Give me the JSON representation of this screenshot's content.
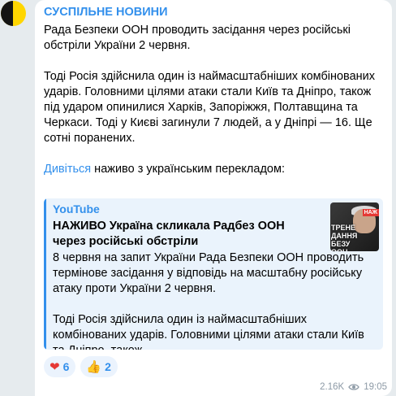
{
  "channel": {
    "name": "СУСПІЛЬНЕ НОВИНИ",
    "avatar_colors": [
      "#141414",
      "#ffd600"
    ]
  },
  "message": {
    "paragraphs": [
      "Рада Безпеки ООН проводить засідання через російські обстріли України 2 червня.",
      "Тоді Росія здійснила один із наймасштабніших комбінованих ударів. Головними цілями атаки стали Київ та Дніпро, також під ударом опинилися Харків, Запоріжжя, Полтавщина та Черкаси. Тоді у Києві загинули 7 людей, а у Дніпрі — 16. Ще сотні поранених."
    ],
    "link_text": "Дивіться",
    "link_suffix": " наживо з українським перекладом:"
  },
  "preview": {
    "site": "YouTube",
    "title": "НАЖИВО Україна скликала Радбез ООН через російські обстріли",
    "description": [
      "8 червня на запит України Рада Безпеки ООН проводить термінове засідання у відповідь на масштабну російську атаку проти України 2 червня.",
      "Тоді Росія здійснила один із наймасштабніших комбінованих ударів. Головними цілями атаки стали Київ та Дніпро, також..."
    ],
    "thumbnail": {
      "tag": "НАЖ",
      "caption": "ТРЕНЕ ДАННЯ БЕЗУ ООН"
    }
  },
  "reactions": [
    {
      "emoji": "heart-icon",
      "glyph": "❤",
      "count": "6"
    },
    {
      "emoji": "thumbs-up-icon",
      "glyph": "👍",
      "count": "2"
    }
  ],
  "meta": {
    "views": "2.16K",
    "time": "19:05"
  },
  "colors": {
    "accent": "#3390ec",
    "background": "#e6ebee",
    "bubble": "#ffffff",
    "preview_bg": "#eaf3fc"
  }
}
